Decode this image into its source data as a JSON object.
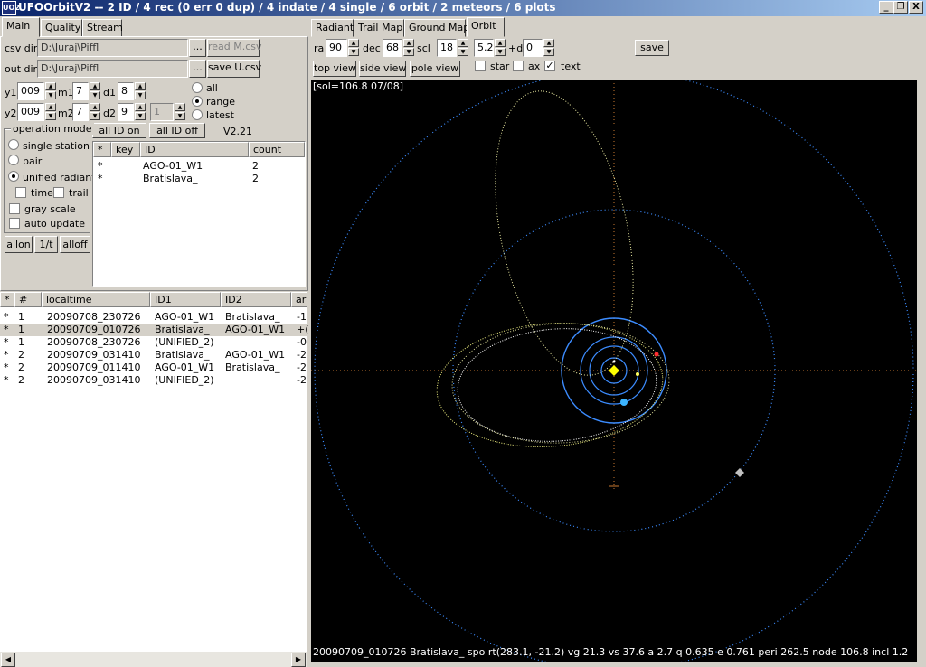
{
  "window": {
    "title": "UFOOrbitV2 -- 2 ID / 4 rec (0 err 0 dup) / 4 indate / 4 single / 6 orbit / 2 meteors / 6 plots",
    "icon_text": "UO2",
    "buttons": [
      "_",
      "❐",
      "X"
    ]
  },
  "left_tabs": [
    "Main",
    "Quality",
    "Stream"
  ],
  "right_tabs": [
    "Radiant",
    "Trail Map",
    "Ground Map",
    "Orbit"
  ],
  "main": {
    "csv_dir_label": "csv dir",
    "csv_dir_value": "D:\\Juraj\\Piffl",
    "out_dir_label": "out dir",
    "out_dir_value": "D:\\Juraj\\Piffl",
    "browse_label": "...",
    "read_button": "read M.csv",
    "save_button": "save U.csv",
    "y1_label": "y1",
    "y1_value": "009",
    "m1_label": "m1",
    "m1_value": "7",
    "d1_label": "d1",
    "d1_value": "8",
    "y2_label": "y2",
    "y2_value": "009",
    "m2_label": "m2",
    "m2_value": "7",
    "d2_label": "d2",
    "d2_value": "9",
    "latest_value": "1",
    "radio_all": "all",
    "radio_range": "range",
    "radio_latest": "latest",
    "all_id_on": "all ID on",
    "all_id_off": "all ID off",
    "version": "V2.21",
    "op_mode_label": "operation mode",
    "op_single": "single station",
    "op_pair": "pair",
    "op_unified": "unified radiant",
    "time_label": "time",
    "trail_label": "trail",
    "gray_label": "gray scale",
    "auto_label": "auto update",
    "allon": "allon",
    "one_t": "1/t",
    "alloff": "alloff",
    "id_list": {
      "headers": [
        "*",
        "key",
        "ID",
        "count"
      ],
      "rows": [
        {
          "star": "*",
          "key": "",
          "id": "AGO-01_W1",
          "count": "2"
        },
        {
          "star": "*",
          "key": "",
          "id": "Bratislava_",
          "count": "2"
        }
      ]
    }
  },
  "records": {
    "headers": [
      "*",
      "#",
      "localtime",
      "ID1",
      "ID2",
      "ar"
    ],
    "rows": [
      {
        "star": "*",
        "num": "1",
        "time": "20090708_230726",
        "id1": "AGO-01_W1",
        "id2": "Bratislava_",
        "extra": "-1"
      },
      {
        "star": "*",
        "num": "1",
        "time": "20090709_010726",
        "id1": "Bratislava_",
        "id2": "AGO-01_W1",
        "extra": "+("
      },
      {
        "star": "*",
        "num": "1",
        "time": "20090708_230726",
        "id1": "(UNIFIED_2)",
        "id2": "",
        "extra": "-0"
      },
      {
        "star": "*",
        "num": "2",
        "time": "20090709_031410",
        "id1": "Bratislava_",
        "id2": "AGO-01_W1",
        "extra": "-2"
      },
      {
        "star": "*",
        "num": "2",
        "time": "20090709_011410",
        "id1": "AGO-01_W1",
        "id2": "Bratislava_",
        "extra": "-2"
      },
      {
        "star": "*",
        "num": "2",
        "time": "20090709_031410",
        "id1": "(UNIFIED_2)",
        "id2": "",
        "extra": "-2"
      }
    ]
  },
  "orbit": {
    "ra_label": "ra",
    "ra_value": "90",
    "dec_label": "dec",
    "dec_value": "68",
    "scl_label": "scl",
    "scl_value": "18",
    "val2": "5.2",
    "d_label": "+d",
    "d_value": "0",
    "save": "save",
    "top_view": "top view",
    "side_view": "side view",
    "pole_view": "pole view",
    "star_label": "star",
    "ax_label": "ax",
    "text_label": "text",
    "text_checked": "✓",
    "sol_text": "[sol=106.8 07/08]",
    "info_text": "20090709_010726 Bratislava_ spo rt(283.1, -21.2) vg 21.3 vs 37.6 a 2.7 q 0.635 e 0.761 peri 262.5 node 106.8 incl 1.2"
  },
  "colors": {
    "orbit_blue": "#3c8cff",
    "orbit_yellow": "#f0f080",
    "sun": "#ffff00",
    "axis_orange": "#c87830"
  }
}
